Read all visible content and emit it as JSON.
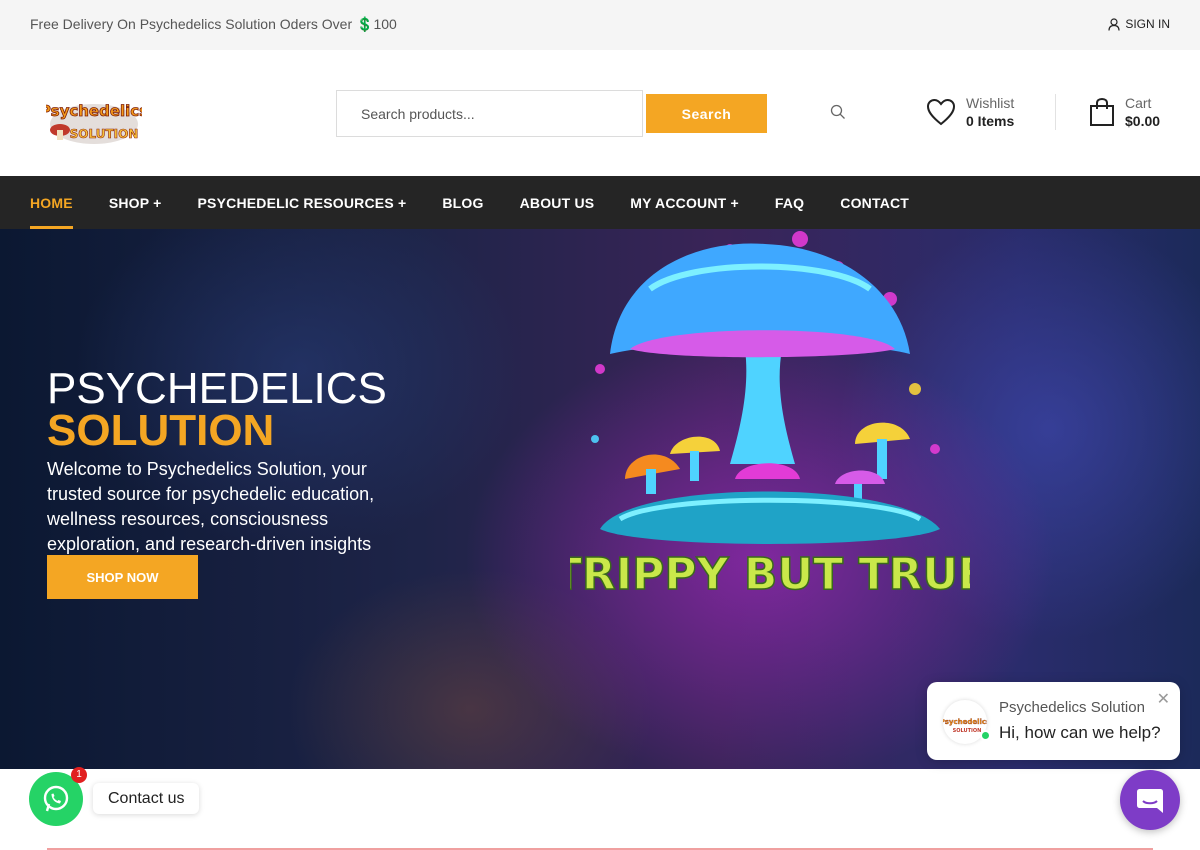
{
  "topbar": {
    "promo": "Free Delivery On Psychedelics Solution Oders Over 💲100",
    "signin": "SIGN IN"
  },
  "header": {
    "logo_text": "Psychedelics Solution",
    "search_placeholder": "Search products...",
    "search_button": "Search",
    "wishlist_label": "Wishlist",
    "wishlist_value": "0 Items",
    "cart_label": "Cart",
    "cart_value": "$0.00"
  },
  "nav": {
    "items": [
      {
        "label": "HOME",
        "active": true
      },
      {
        "label": "SHOP +"
      },
      {
        "label": "PSYCHEDELIC RESOURCES +"
      },
      {
        "label": "BLOG"
      },
      {
        "label": "ABOUT US"
      },
      {
        "label": "MY ACCOUNT +"
      },
      {
        "label": "FAQ"
      },
      {
        "label": "CONTACT"
      }
    ]
  },
  "hero": {
    "title_line1": "PSYCHEDELICS",
    "title_line2": "SOLUTION",
    "description": "Welcome to Psychedelics Solution, your trusted source for psychedelic education, wellness resources, consciousness exploration, and research-driven insights",
    "cta": "SHOP NOW",
    "art_caption": "TRIPPY BUT TRUE"
  },
  "chat": {
    "name": "Psychedelics Solution",
    "message": "Hi, how can we help?"
  },
  "whatsapp": {
    "badge": "1",
    "label": "Contact us"
  },
  "colors": {
    "accent": "#f4a623",
    "nav_bg": "#252525",
    "whatsapp": "#25d366",
    "chat_fab": "#7e3cc7"
  }
}
